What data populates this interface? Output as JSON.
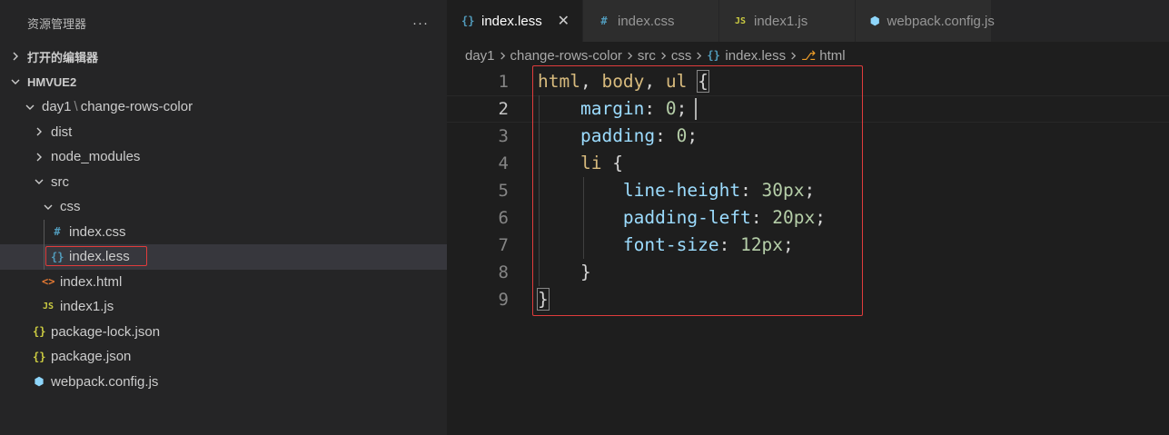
{
  "sidebar": {
    "title": "资源管理器",
    "more_label": "···",
    "sections": [
      {
        "label": "打开的编辑器",
        "expanded": false
      },
      {
        "label": "HMVUE2",
        "expanded": true
      }
    ],
    "tree": [
      {
        "label": "day1",
        "label2": "change-rows-color",
        "sep": "\\",
        "icon": "folder-open",
        "depth": 0
      },
      {
        "label": "dist",
        "icon": "folder",
        "depth": 1
      },
      {
        "label": "node_modules",
        "icon": "folder",
        "depth": 1
      },
      {
        "label": "src",
        "icon": "folder-open",
        "depth": 1
      },
      {
        "label": "css",
        "icon": "folder-open",
        "depth": 2
      },
      {
        "label": "index.css",
        "icon": "css-file-icon",
        "glyph": "#",
        "depth": 3
      },
      {
        "label": "index.less",
        "icon": "less-file-icon",
        "glyph": "{}",
        "depth": 3,
        "selected": true
      },
      {
        "label": "index.html",
        "icon": "html-file-icon",
        "glyph": "<>",
        "depth": 2
      },
      {
        "label": "index1.js",
        "icon": "js-file-icon",
        "glyph": "JS",
        "depth": 2
      },
      {
        "label": "package-lock.json",
        "icon": "json-file-icon",
        "glyph": "{}",
        "depth": 1
      },
      {
        "label": "package.json",
        "icon": "json-file-icon",
        "glyph": "{}",
        "depth": 1
      },
      {
        "label": "webpack.config.js",
        "icon": "webpack-file-icon",
        "glyph": "⬢",
        "depth": 1
      }
    ]
  },
  "tabs": [
    {
      "label": "index.less",
      "glyph": "{}",
      "icon": "less-file-icon",
      "active": true,
      "close": "✕"
    },
    {
      "label": "index.css",
      "glyph": "#",
      "icon": "css-file-icon"
    },
    {
      "label": "index1.js",
      "glyph": "JS",
      "icon": "js-file-icon"
    },
    {
      "label": "webpack.config.js",
      "glyph": "⬢",
      "icon": "webpack-file-icon"
    }
  ],
  "breadcrumb": {
    "parts": [
      "day1",
      "change-rows-color",
      "src",
      "css"
    ],
    "file": {
      "glyph": "{}",
      "label": "index.less"
    },
    "symbol": {
      "glyph": "⎇",
      "label": "html"
    }
  },
  "editor": {
    "current_line": 2,
    "lines": [
      {
        "n": "1",
        "tokens": [
          [
            "sel",
            "html"
          ],
          [
            "punc",
            ", "
          ],
          [
            "sel",
            "body"
          ],
          [
            "punc",
            ", "
          ],
          [
            "sel",
            "ul"
          ],
          [
            "punc",
            " "
          ],
          [
            "punc",
            "{"
          ]
        ]
      },
      {
        "n": "2",
        "tokens": [
          [
            "punc",
            "    "
          ],
          [
            "prop",
            "margin"
          ],
          [
            "punc",
            ": "
          ],
          [
            "num",
            "0"
          ],
          [
            "punc",
            ";"
          ]
        ]
      },
      {
        "n": "3",
        "tokens": [
          [
            "punc",
            "    "
          ],
          [
            "prop",
            "padding"
          ],
          [
            "punc",
            ": "
          ],
          [
            "num",
            "0"
          ],
          [
            "punc",
            ";"
          ]
        ]
      },
      {
        "n": "4",
        "tokens": [
          [
            "punc",
            "    "
          ],
          [
            "sel",
            "li"
          ],
          [
            "punc",
            " {"
          ]
        ]
      },
      {
        "n": "5",
        "tokens": [
          [
            "punc",
            "        "
          ],
          [
            "prop",
            "line-height"
          ],
          [
            "punc",
            ": "
          ],
          [
            "num",
            "30px"
          ],
          [
            "punc",
            ";"
          ]
        ]
      },
      {
        "n": "6",
        "tokens": [
          [
            "punc",
            "        "
          ],
          [
            "prop",
            "padding-left"
          ],
          [
            "punc",
            ": "
          ],
          [
            "num",
            "20px"
          ],
          [
            "punc",
            ";"
          ]
        ]
      },
      {
        "n": "7",
        "tokens": [
          [
            "punc",
            "        "
          ],
          [
            "prop",
            "font-size"
          ],
          [
            "punc",
            ": "
          ],
          [
            "num",
            "12px"
          ],
          [
            "punc",
            ";"
          ]
        ]
      },
      {
        "n": "8",
        "tokens": [
          [
            "punc",
            "    }"
          ]
        ]
      },
      {
        "n": "9",
        "tokens": [
          [
            "punc",
            "}"
          ]
        ]
      }
    ]
  },
  "colors": {
    "selector": "#d7ba7d",
    "property": "#9cdcfe",
    "number": "#b5cea8",
    "annotation_box": "#e03c3c"
  }
}
